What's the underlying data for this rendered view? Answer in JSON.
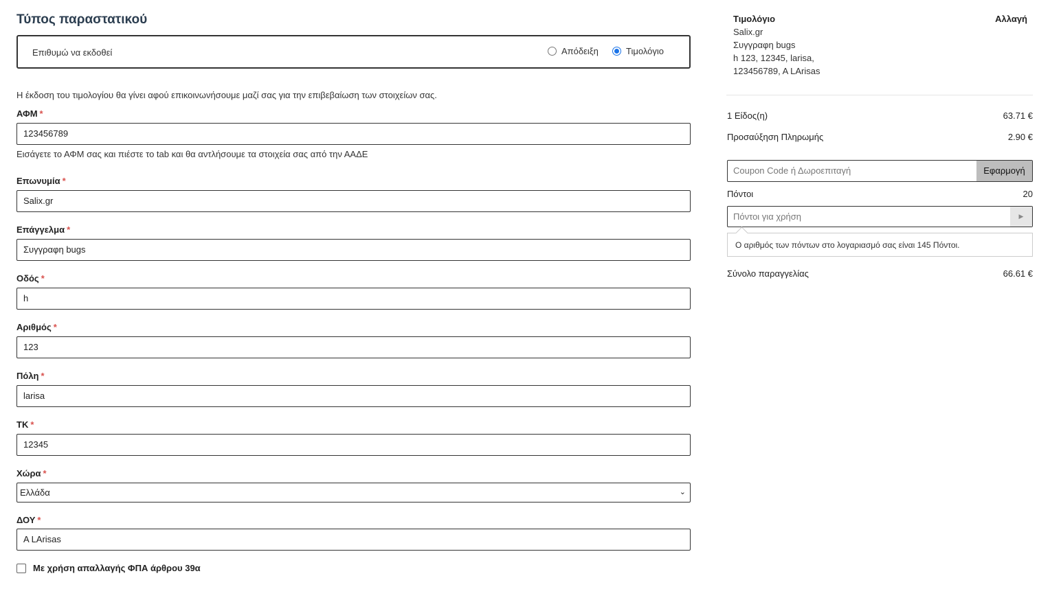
{
  "form": {
    "title": "Τύπος παραστατικού",
    "doc_type": {
      "desire_label": "Επιθυμώ να εκδοθεί",
      "options": [
        {
          "label": "Απόδειξη",
          "selected": false
        },
        {
          "label": "Τιμολόγιο",
          "selected": true
        }
      ]
    },
    "notice": "Η έκδοση του τιμολογίου θα γίνει αφού επικοινωνήσουμε μαζί σας για την επιβεβαίωση των στοιχείων σας.",
    "required_mark": "*",
    "fields": {
      "afm": {
        "label": "ΑΦΜ",
        "value": "123456789",
        "hint": "Εισάγετε το ΑΦΜ σας και πιέστε το tab και θα αντλήσουμε τα στοιχεία σας από την ΑΑΔΕ"
      },
      "company": {
        "label": "Επωνυμία",
        "value": "Salix.gr"
      },
      "profession": {
        "label": "Επάγγελμα",
        "value": "Συγγραφη bugs"
      },
      "street": {
        "label": "Οδός",
        "value": "h"
      },
      "number": {
        "label": "Αριθμός",
        "value": "123"
      },
      "city": {
        "label": "Πόλη",
        "value": "larisa"
      },
      "zip": {
        "label": "ΤΚ",
        "value": "12345"
      },
      "country": {
        "label": "Χώρα",
        "value": "Ελλάδα"
      },
      "tax_office": {
        "label": "ΔΟΥ",
        "value": "A LArisas"
      }
    },
    "vat_exemption": {
      "label": "Με χρήση απαλλαγής ΦΠΑ άρθρου 39α",
      "checked": false
    }
  },
  "summary": {
    "invoice": {
      "title": "Τιμολόγιο",
      "change": "Αλλαγή",
      "lines": [
        "Salix.gr",
        "Συγγραφη bugs",
        "h 123, 12345, larisa,",
        "123456789, A LArisas"
      ]
    },
    "items_label": "1 Είδος(η)",
    "items_value": "63.71 €",
    "surcharge_label": "Προσαύξηση Πληρωμής",
    "surcharge_value": "2.90 €",
    "coupon_placeholder": "Coupon Code ή Δωροεπιταγή",
    "coupon_button": "Εφαρμογή",
    "points_label": "Πόντοι",
    "points_value": "20",
    "points_placeholder": "Πόντοι για χρήση",
    "points_go_icon": "play-triangle-icon",
    "points_tip": "Ο αριθμός των πόντων στο λογαριασμό σας είναι 145 Πόντοι.",
    "total_label": "Σύνολο παραγγελίας",
    "total_value": "66.61 €"
  },
  "colors": {
    "title": "#2c3e50",
    "required": "#d9534f",
    "radio_selected": "#1a73e8",
    "apply_button_bg": "#bdbdbd"
  }
}
